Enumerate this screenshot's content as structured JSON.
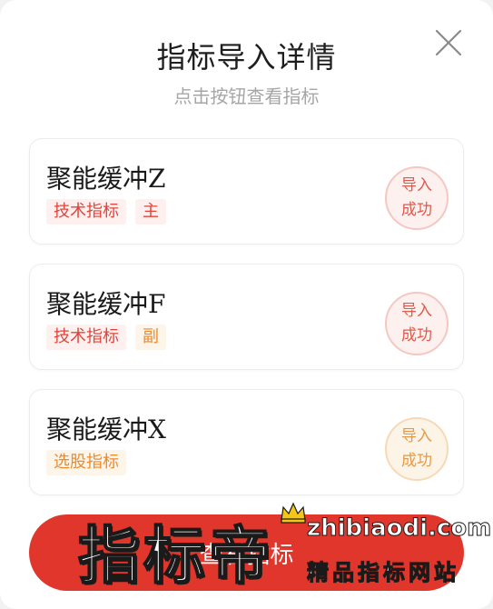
{
  "dialog": {
    "title": "指标导入详情",
    "subtitle": "点击按钮查看指标"
  },
  "indicators": [
    {
      "name": "聚能缓冲Z",
      "tags": [
        "技术指标",
        "主"
      ],
      "status_line1": "导入",
      "status_line2": "成功"
    },
    {
      "name": "聚能缓冲F",
      "tags": [
        "技术指标",
        "副"
      ],
      "status_line1": "导入",
      "status_line2": "成功"
    },
    {
      "name": "聚能缓冲X",
      "tags": [
        "选股指标"
      ],
      "status_line1": "导入",
      "status_line2": "成功"
    }
  ],
  "bottom_button": {
    "label": "查看指标"
  },
  "watermark": {
    "brand": "指标帝",
    "site": "zhibiaodi.com",
    "slogan": "精品指标网站"
  },
  "colors": {
    "accent_red": "#e0362c",
    "tag_red": "#e0453b",
    "tag_orange": "#ef8a2a"
  },
  "icons": {
    "close": "close-icon",
    "crown": "crown-icon"
  }
}
